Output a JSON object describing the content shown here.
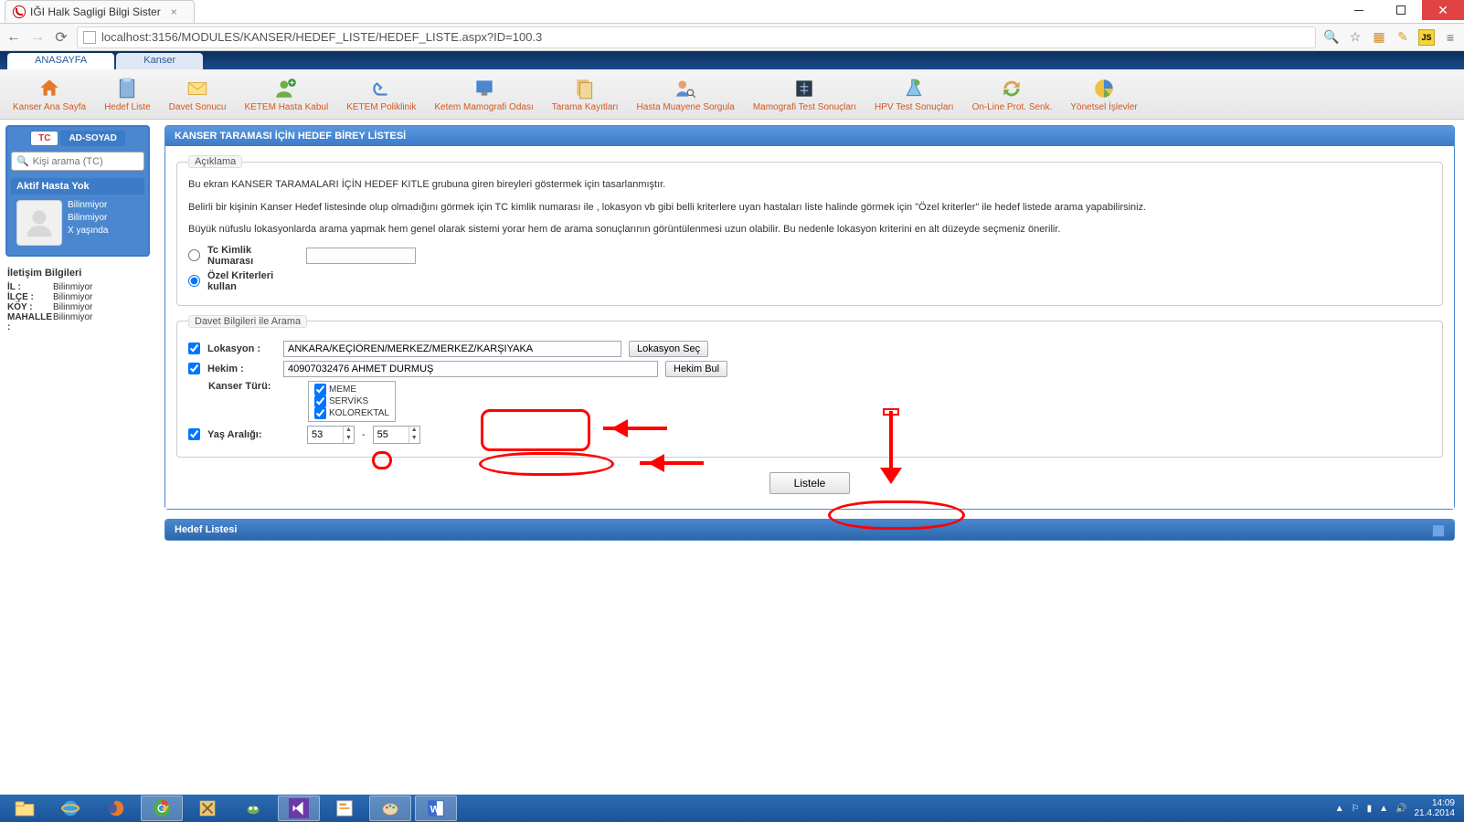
{
  "window": {
    "tab_title": "IĞI Halk Sagligi Bilgi Sister",
    "close": "✕"
  },
  "address": {
    "url": "localhost:3156/MODULES/KANSER/HEDEF_LISTE/HEDEF_LISTE.aspx?ID=100.3"
  },
  "app_tabs": {
    "home": "ANASAYFA",
    "kanser": "Kanser"
  },
  "toolbar": [
    "Kanser Ana Sayfa",
    "Hedef Liste",
    "Davet Sonucu",
    "KETEM Hasta Kabul",
    "KETEM Poliklinik",
    "Ketem Mamografi Odası",
    "Tarama Kayıtları",
    "Hasta Muayene Sorgula",
    "Mamografi Test Sonuçları",
    "HPV Test Sonuçları",
    "On-Line Prot. Senk.",
    "Yönetsel İşlevler"
  ],
  "sidebar": {
    "toggle_tc": "TC",
    "toggle_name": "AD-SOYAD",
    "search_placeholder": "Kişi arama (TC)",
    "active_header": "Aktif Hasta Yok",
    "p1": "Bilinmiyor",
    "p2": "Bilinmiyor",
    "p3": "X yaşında",
    "contact_header": "İletişim Bilgileri",
    "il_k": "İL :",
    "il_v": "Bilinmiyor",
    "ilce_k": "İLÇE :",
    "ilce_v": "Bilinmiyor",
    "koy_k": "KÖY :",
    "koy_v": "Bilinmiyor",
    "mah_k": "MAHALLE :",
    "mah_v": "Bilinmiyor"
  },
  "panel": {
    "title": "KANSER TARAMASI İÇİN HEDEF BİREY LİSTESİ",
    "legend_aciklama": "Açıklama",
    "desc1": "Bu ekran KANSER TARAMALARI İÇİN HEDEF KITLE grubuna giren bireyleri göstermek için tasarlanmıştır.",
    "desc2": "Belirli bir kişinin Kanser Hedef listesinde olup olmadığını görmek için TC kimlik numarası ile , lokasyon vb gibi belli kriterlere uyan hastaları liste halinde görmek için \"Özel kriterler\" ile hedef listede arama yapabilirsiniz.",
    "desc3": "Büyük nüfuslu lokasyonlarda arama yapmak hem genel olarak sistemi yorar hem de arama sonuçlarının görüntülenmesi uzun olabilir. Bu nedenle lokasyon kriterini en alt düzeyde seçmeniz önerilir.",
    "radio_tc": "Tc Kimlik Numarası",
    "radio_ozel": "Özel Kriterleri kullan",
    "legend_davet": "Davet Bilgileri ile Arama",
    "lokasyon_label": "Lokasyon :",
    "lokasyon_value": "ANKARA/KEÇİÖREN/MERKEZ/MERKEZ/KARŞIYAKA",
    "lokasyon_btn": "Lokasyon Seç",
    "hekim_label": "Hekim :",
    "hekim_value": "40907032476 AHMET DURMUŞ",
    "hekim_btn": "Hekim Bul",
    "kanser_label": "Kanser Türü:",
    "opt_meme": "MEME",
    "opt_serviks": "SERVİKS",
    "opt_kolo": "KOLOREKTAL",
    "yas_label": "Yaş Aralığı:",
    "yas_min": "53",
    "yas_sep": "-",
    "yas_max": "55",
    "listele": "Listele",
    "hedef_title": "Hedef Listesi"
  },
  "tray": {
    "time": "14:09",
    "date": "21.4.2014"
  }
}
